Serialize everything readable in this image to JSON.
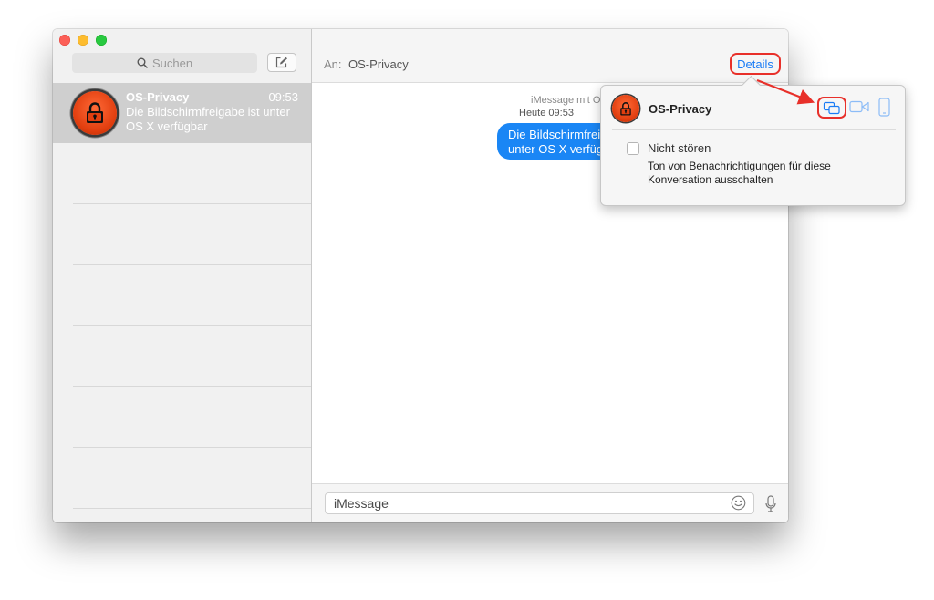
{
  "sidebar": {
    "search_placeholder": "Suchen",
    "conversations": [
      {
        "name": "OS-Privacy",
        "time": "09:53",
        "preview": "Die Bildschirmfreigabe ist unter OS X verfügbar"
      }
    ]
  },
  "header": {
    "to_label": "An:",
    "recipient": "OS-Privacy",
    "details_label": "Details"
  },
  "conversation": {
    "service_label": "iMessage mit OS-Privacy",
    "time_label": "Heute 09:53",
    "message": "Die Bildschirmfreigabe ist unter OS X verfügbar"
  },
  "footer": {
    "input_placeholder": "iMessage"
  },
  "details_popover": {
    "contact_name": "OS-Privacy",
    "dnd_label": "Nicht stören",
    "dnd_checked": false,
    "dnd_description": "Ton von Benachrichtigungen für diese Konversation ausschalten",
    "actions": [
      "screen-share-icon",
      "video-camera-icon",
      "phone-icon"
    ]
  },
  "colors": {
    "accent": "#1a7cf5",
    "bubble": "#1a86f5",
    "annotation": "#e8302a",
    "avatar": "#e13e0f",
    "selection": "#cfcfcf"
  }
}
